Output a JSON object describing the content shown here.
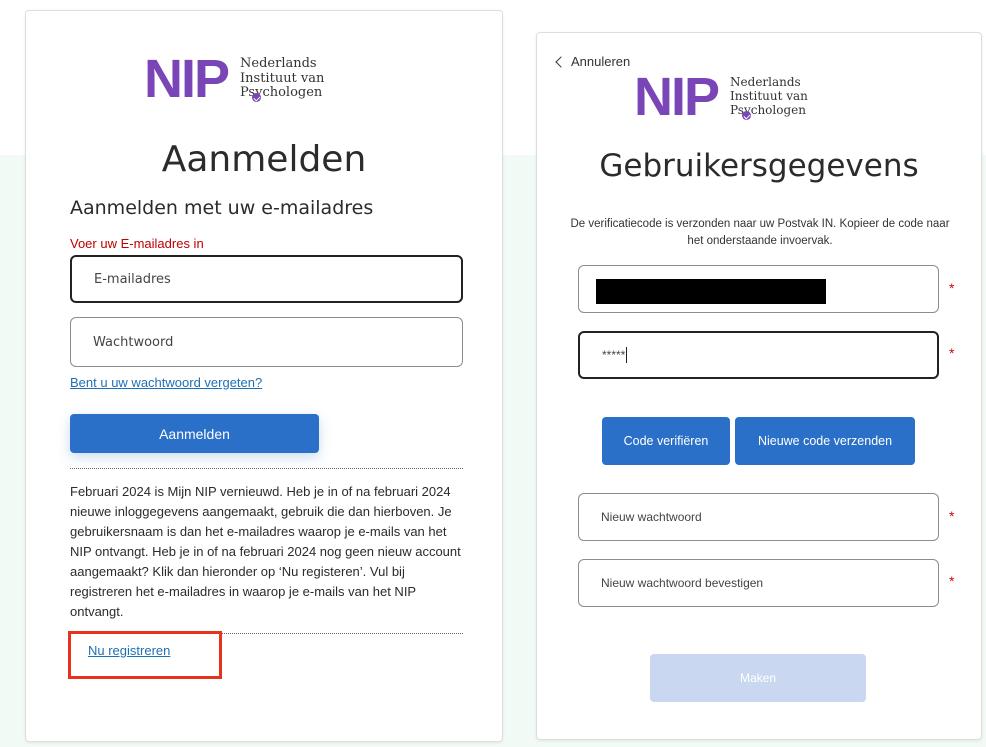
{
  "brand": {
    "mark": "NIP",
    "line1": "Nederlands",
    "line2": "Instituut van",
    "line3": "Psychologen",
    "color": "#7a45b6"
  },
  "signin": {
    "title": "Aanmelden",
    "subtitle": "Aanmelden met uw e-mailadres",
    "email_error": "Voer uw E-mailadres in",
    "email_placeholder": "E-mailadres",
    "password_placeholder": "Wachtwoord",
    "forgot_link": "Bent u uw wachtwoord vergeten?",
    "signin_button": "Aanmelden",
    "info": "Februari 2024 is Mijn NIP vernieuwd. Heb je in of na februari 2024 nieuwe inloggegevens aangemaakt, gebruik die dan hierboven. Je gebruikersnaam is dan het e-mailadres waarop je e-mails van het NIP ontvangt. Heb je in of na februari 2024 nog geen nieuw account aangemaakt? Klik dan hieronder op ‘Nu registeren’. Vul bij registreren het e-mailadres in waarop je e-mails van het NIP ontvangt.",
    "register_link": "Nu registreren"
  },
  "register": {
    "cancel_label": "Annuleren",
    "title": "Gebruikersgegevens",
    "verify_message": "De verificatiecode is verzonden naar uw Postvak IN. Kopieer de code naar het onderstaande invoervak.",
    "code_value": "*****",
    "verify_code_button": "Code verifiëren",
    "resend_code_button": "Nieuwe code verzenden",
    "new_password_placeholder": "Nieuw wachtwoord",
    "confirm_password_placeholder": "Nieuw wachtwoord bevestigen",
    "required_marker": "*",
    "create_button": "Maken"
  },
  "colors": {
    "primary_button": "#2a70c8",
    "disabled_button": "#c9d8f0",
    "error": "#c00000",
    "link": "#1f6fb5",
    "highlight": "#e8321e"
  }
}
